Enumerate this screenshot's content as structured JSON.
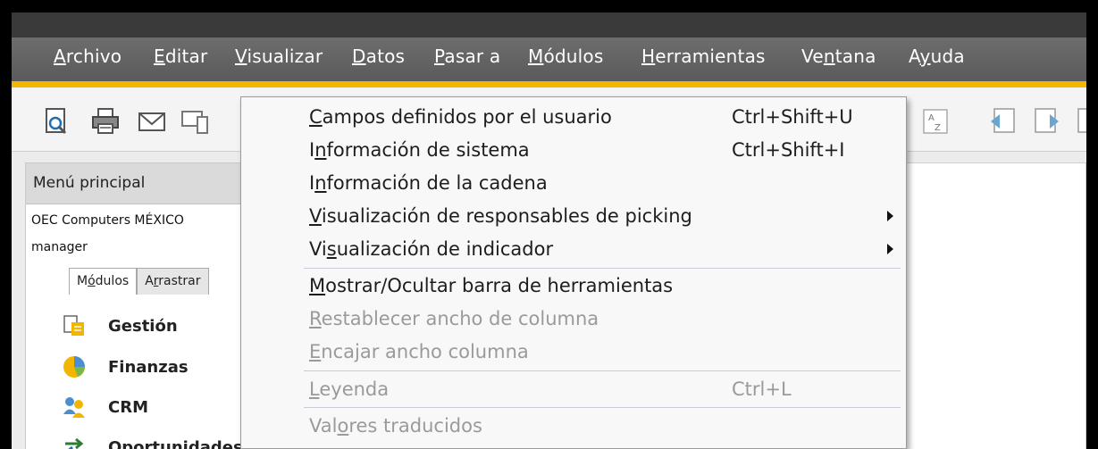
{
  "menubar": {
    "items": [
      {
        "pre": "",
        "key": "A",
        "post": "rchivo"
      },
      {
        "pre": "",
        "key": "E",
        "post": "ditar"
      },
      {
        "pre": "",
        "key": "V",
        "post": "isualizar"
      },
      {
        "pre": "",
        "key": "D",
        "post": "atos"
      },
      {
        "pre": "",
        "key": "P",
        "post": "asar a"
      },
      {
        "pre": "",
        "key": "M",
        "post": "ódulos"
      },
      {
        "pre": "",
        "key": "H",
        "post": "erramientas"
      },
      {
        "pre": "Ve",
        "key": "n",
        "post": "tana"
      },
      {
        "pre": "A",
        "key": "y",
        "post": "uda"
      }
    ]
  },
  "sidebar": {
    "title": "Menú principal",
    "company": "OEC Computers MÉXICO",
    "user": "manager",
    "tabs": [
      {
        "pre": "M",
        "key": "ó",
        "post": "dulos"
      },
      {
        "pre": "A",
        "key": "r",
        "post": "rastrar"
      }
    ],
    "modules": [
      "Gestión",
      "Finanzas",
      "CRM",
      "Oportunidades"
    ]
  },
  "dropdown": {
    "items": [
      {
        "pre": "",
        "key": "C",
        "post": "ampos definidos por el usuario",
        "shortcut": "Ctrl+Shift+U",
        "disabled": false
      },
      {
        "pre": "I",
        "key": "n",
        "post": "formación de sistema",
        "shortcut": "Ctrl+Shift+I",
        "disabled": false
      },
      {
        "pre": "I",
        "key": "n",
        "post": "formación de la cadena",
        "shortcut": "",
        "disabled": false
      },
      {
        "pre": "",
        "key": "V",
        "post": "isualización de responsables de picking",
        "shortcut": "",
        "disabled": false
      },
      {
        "pre": "Vi",
        "key": "s",
        "post": "ualización de indicador",
        "shortcut": "",
        "disabled": false
      },
      {
        "pre": "",
        "key": "M",
        "post": "ostrar/Ocultar barra de herramientas",
        "shortcut": "",
        "disabled": false
      },
      {
        "pre": "",
        "key": "R",
        "post": "establecer ancho de columna",
        "shortcut": "",
        "disabled": true
      },
      {
        "pre": "",
        "key": "E",
        "post": "ncajar ancho columna",
        "shortcut": "",
        "disabled": true
      },
      {
        "pre": "",
        "key": "L",
        "post": "eyenda",
        "shortcut": "Ctrl+L",
        "disabled": true
      },
      {
        "pre": "Val",
        "key": "o",
        "post": "res traducidos",
        "shortcut": "",
        "disabled": true
      }
    ]
  }
}
